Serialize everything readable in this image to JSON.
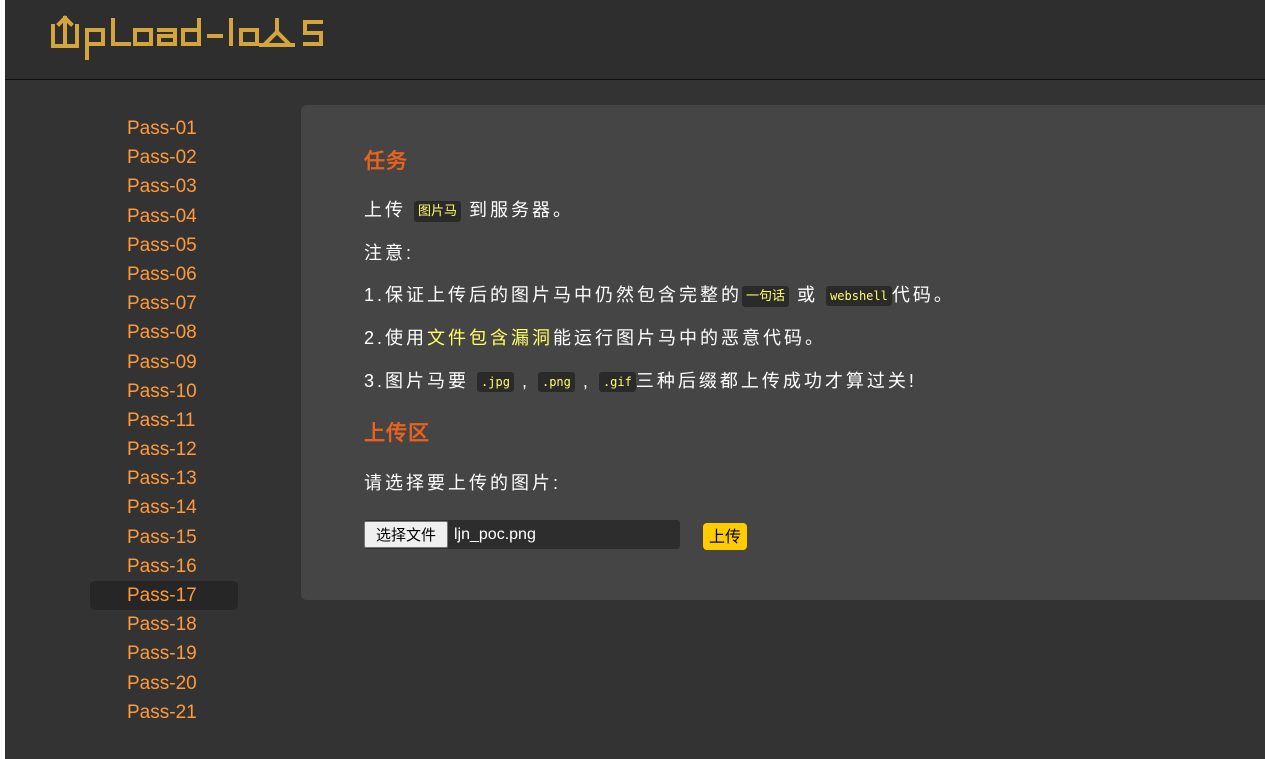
{
  "brand": {
    "logo_text": "UpLoad-labs",
    "color": "#d4a53c"
  },
  "sidebar": {
    "active": "Pass-17",
    "items": [
      "Pass-01",
      "Pass-02",
      "Pass-03",
      "Pass-04",
      "Pass-05",
      "Pass-06",
      "Pass-07",
      "Pass-08",
      "Pass-09",
      "Pass-10",
      "Pass-11",
      "Pass-12",
      "Pass-13",
      "Pass-14",
      "Pass-15",
      "Pass-16",
      "Pass-17",
      "Pass-18",
      "Pass-19",
      "Pass-20",
      "Pass-21"
    ]
  },
  "task": {
    "title": "任务",
    "line1_pre": "上传",
    "line1_code": "图片马",
    "line1_post": "到服务器。",
    "note": "注意:",
    "item1_pre": "1.保证上传后的图片马中仍然包含完整的",
    "item1_code1": "一句话",
    "item1_mid": "或",
    "item1_code2": "webshell",
    "item1_post": "代码。",
    "item2_pre": "2.使用",
    "item2_hl": "文件包含漏洞",
    "item2_post": "能运行图片马中的恶意代码。",
    "item3_pre": "3.图片马要",
    "item3_code1": ".jpg",
    "item3_sep1": ",",
    "item3_code2": ".png",
    "item3_sep2": ",",
    "item3_code3": ".gif",
    "item3_post": "三种后缀都上传成功才算过关!"
  },
  "upload": {
    "title": "上传区",
    "prompt": "请选择要上传的图片:",
    "choose_label": "选择文件",
    "file_name": "ljn_poc.png",
    "submit_label": "上传"
  },
  "colors": {
    "accent_orange": "#e8621e",
    "link_orange": "#ff9a3c",
    "highlight_yellow": "#ffff66",
    "button_yellow": "#ffcc00"
  }
}
